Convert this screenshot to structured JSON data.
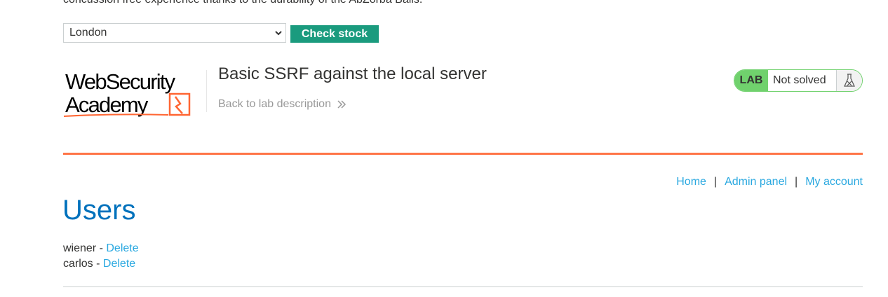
{
  "product": {
    "description_fragment": "concussion free experience thanks to the durability of the AbZorba Balls."
  },
  "stock_check": {
    "selected_store": "London",
    "button_label": "Check stock"
  },
  "header": {
    "logo_line1": "WebSecurity",
    "logo_line2": "Academy",
    "lab_title": "Basic SSRF against the local server",
    "back_link": "Back to lab description",
    "lab_badge": "LAB",
    "lab_status": "Not solved"
  },
  "nav": {
    "home": "Home",
    "admin_panel": "Admin panel",
    "my_account": "My account",
    "separator": "|"
  },
  "main": {
    "heading": "Users",
    "users": [
      {
        "name": "wiener",
        "separator": " - ",
        "action": "Delete"
      },
      {
        "name": "carlos",
        "separator": " - ",
        "action": "Delete"
      }
    ]
  },
  "colors": {
    "accent_orange": "#ff6633",
    "button_green": "#1a9b7e",
    "status_green": "#70d16d",
    "link_blue": "#29a8e0",
    "heading_blue": "#0071bc"
  }
}
